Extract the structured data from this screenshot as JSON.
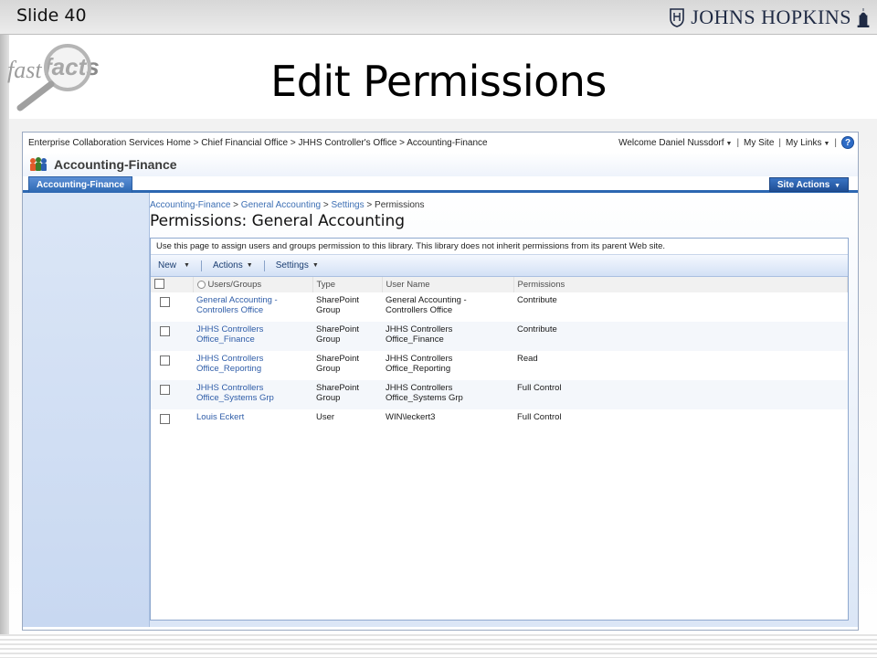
{
  "slide": {
    "number_label": "Slide 40",
    "title": "Edit Permissions",
    "logo_text": "JOHNS HOPKINS",
    "fastfacts_fast": "fast",
    "fastfacts_facts": "facts"
  },
  "global": {
    "breadcrumb": "Enterprise Collaboration Services Home > Chief Financial Office > JHHS Controller's Office > Accounting-Finance",
    "welcome": "Welcome Daniel Nussdorf",
    "my_site": "My Site",
    "my_links": "My Links",
    "separator": "|",
    "help": "?"
  },
  "site": {
    "title": "Accounting-Finance",
    "tab_label": "Accounting-Finance",
    "site_actions": "Site Actions"
  },
  "page": {
    "crumb_1": "Accounting-Finance",
    "crumb_2": "General Accounting",
    "crumb_3": "Settings",
    "crumb_4": "Permissions",
    "crumb_arrow": ">",
    "heading": "Permissions: General Accounting",
    "description": "Use this page to assign users and groups permission to this library. This library does not inherit permissions from its parent Web site."
  },
  "toolbar": {
    "new": "New",
    "actions": "Actions",
    "settings": "Settings"
  },
  "table": {
    "headers": {
      "users_groups": "Users/Groups",
      "type": "Type",
      "user_name": "User Name",
      "permissions": "Permissions"
    },
    "rows": [
      {
        "name_l1": "General Accounting -",
        "name_l2": "Controllers Office",
        "type_l1": "SharePoint",
        "type_l2": "Group",
        "user_l1": "General Accounting -",
        "user_l2": "Controllers Office",
        "permission": "Contribute"
      },
      {
        "name_l1": "JHHS Controllers",
        "name_l2": "Office_Finance",
        "type_l1": "SharePoint",
        "type_l2": "Group",
        "user_l1": "JHHS Controllers",
        "user_l2": "Office_Finance",
        "permission": "Contribute"
      },
      {
        "name_l1": "JHHS Controllers",
        "name_l2": "Office_Reporting",
        "type_l1": "SharePoint",
        "type_l2": "Group",
        "user_l1": "JHHS Controllers",
        "user_l2": "Office_Reporting",
        "permission": "Read"
      },
      {
        "name_l1": "JHHS Controllers",
        "name_l2": "Office_Systems Grp",
        "type_l1": "SharePoint",
        "type_l2": "Group",
        "user_l1": "JHHS Controllers",
        "user_l2": "Office_Systems Grp",
        "permission": "Full Control"
      },
      {
        "name_l1": "Louis Eckert",
        "name_l2": "",
        "type_l1": "User",
        "type_l2": "",
        "user_l1": "WIN\\leckert3",
        "user_l2": "",
        "permission": "Full Control"
      }
    ]
  },
  "colors": {
    "accent_blue": "#2c67b1",
    "link_blue": "#2f5da8",
    "nav_bg": "#c8d8f1"
  }
}
